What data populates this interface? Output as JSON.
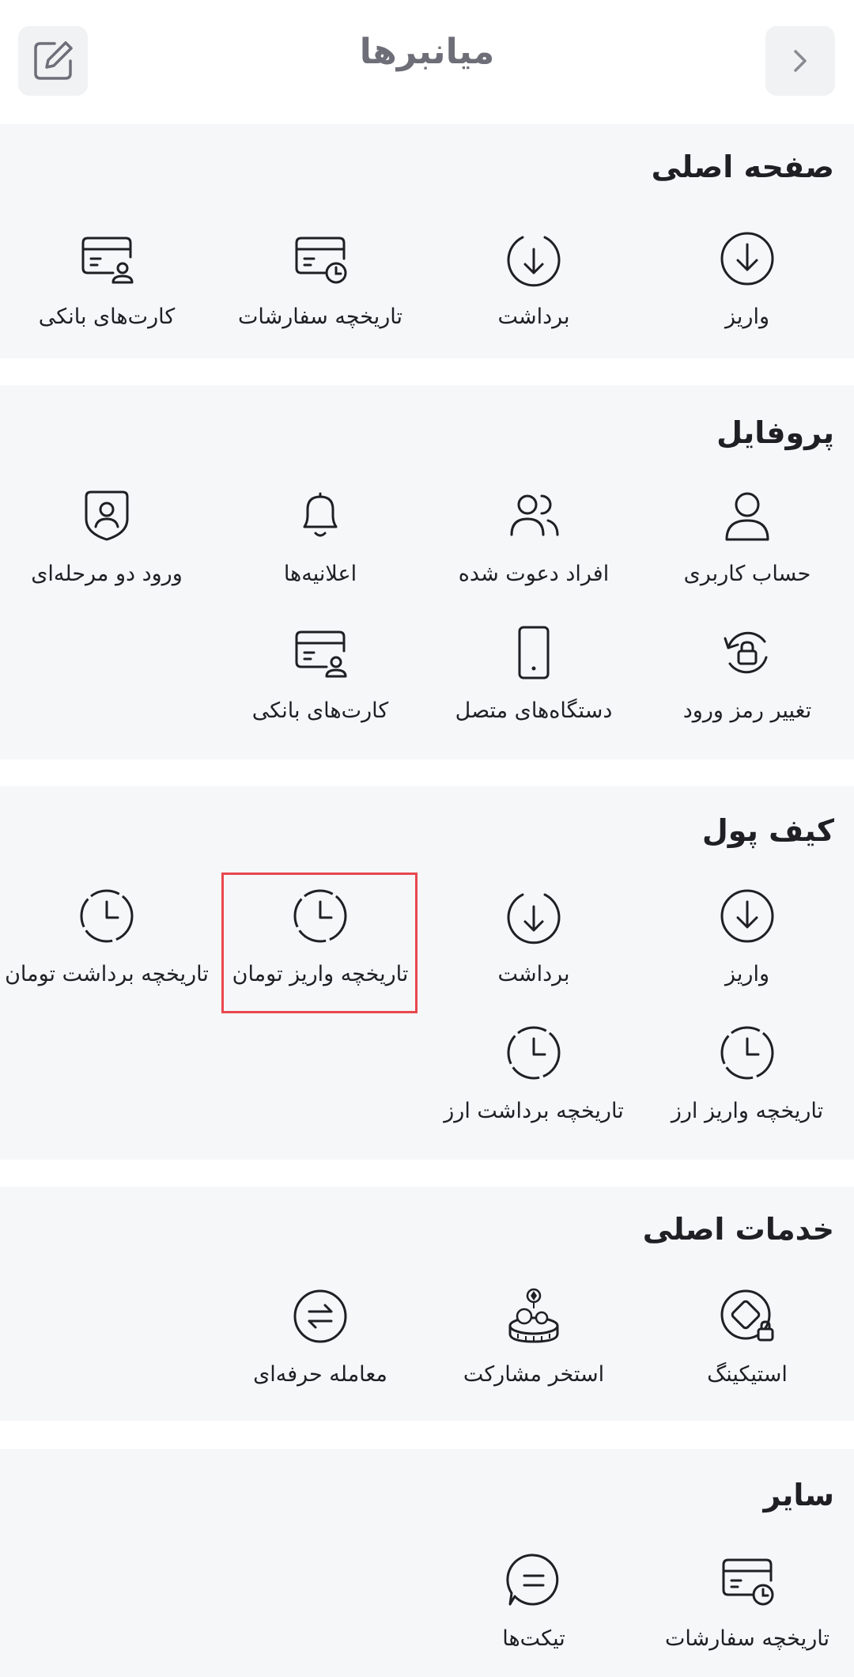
{
  "header": {
    "title": "میانبرها",
    "back_icon": "chevron-right-icon",
    "edit_icon": "edit-icon"
  },
  "colors": {
    "section_bg": "#f6f7f9",
    "title_gray": "#6e6e78",
    "highlight": "#e8484f",
    "icon_stroke": "#1f1f24"
  },
  "sections": {
    "main": {
      "title": "صفحه اصلی",
      "items": [
        {
          "label": "واریز",
          "icon": "deposit-icon"
        },
        {
          "label": "برداشت",
          "icon": "withdraw-icon"
        },
        {
          "label": "تاریخچه سفارشات",
          "icon": "order-history-icon"
        },
        {
          "label": "کارت‌های بانکی",
          "icon": "bank-card-icon"
        }
      ]
    },
    "profile": {
      "title": "پروفایل",
      "items": [
        {
          "label": "حساب کاربری",
          "icon": "user-icon"
        },
        {
          "label": "افراد دعوت شده",
          "icon": "users-icon"
        },
        {
          "label": "اعلانیه‌ها",
          "icon": "bell-icon"
        },
        {
          "label": "ورود دو مرحله‌ای",
          "icon": "shield-user-icon"
        },
        {
          "label": "تغییر رمز ورود",
          "icon": "lock-rotate-icon"
        },
        {
          "label": "دستگاه‌های متصل",
          "icon": "mobile-icon"
        },
        {
          "label": "کارت‌های بانکی",
          "icon": "bank-card-icon"
        }
      ]
    },
    "wallet": {
      "title": "کیف پول",
      "items": [
        {
          "label": "واریز",
          "icon": "deposit-icon"
        },
        {
          "label": "برداشت",
          "icon": "withdraw-icon"
        },
        {
          "label": "تاریخچه واریز تومان",
          "icon": "history-clock-icon",
          "highlighted": true
        },
        {
          "label": "تاریخچه برداشت تومان",
          "icon": "history-clock-icon"
        },
        {
          "label": "تاریخچه واریز ارز",
          "icon": "history-clock-icon"
        },
        {
          "label": "تاریخچه برداشت ارز",
          "icon": "history-clock-icon"
        }
      ]
    },
    "services": {
      "title": "خدمات اصلی",
      "items": [
        {
          "label": "استیکینگ",
          "icon": "staking-icon"
        },
        {
          "label": "استخر مشارکت",
          "icon": "liquidity-pool-icon"
        },
        {
          "label": "معامله حرفه‌ای",
          "icon": "swap-icon"
        }
      ]
    },
    "other": {
      "title": "سایر",
      "items": [
        {
          "label": "تاریخچه سفارشات",
          "icon": "order-history-icon"
        },
        {
          "label": "تیکت‌ها",
          "icon": "ticket-chat-icon"
        }
      ]
    }
  }
}
